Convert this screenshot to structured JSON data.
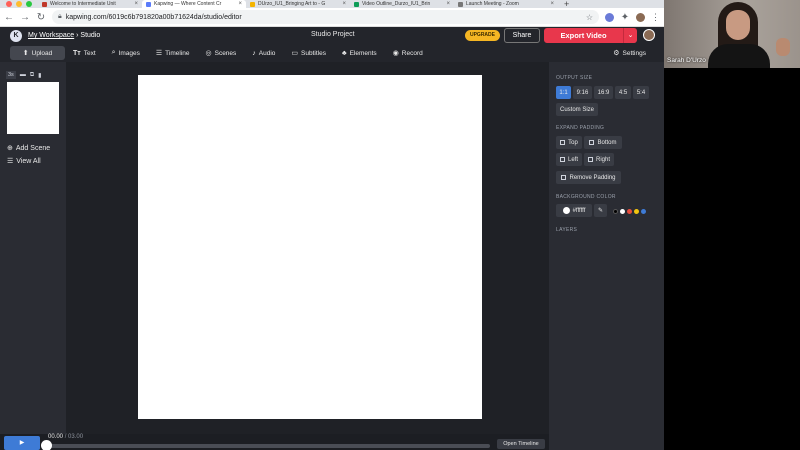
{
  "browser": {
    "tabs": [
      {
        "title": "Welcome to Intermediate Unit",
        "active": false,
        "favicon_color": "#c0392b"
      },
      {
        "title": "Kapwing — Where Content Cr",
        "active": true,
        "favicon_color": "#5b7cfa"
      },
      {
        "title": "DUrzo_IU1_Bringing Art to - G",
        "active": false,
        "favicon_color": "#f4b400"
      },
      {
        "title": "Video Outline_Durzo_IU1_Brin",
        "active": false,
        "favicon_color": "#0f9d58"
      },
      {
        "title": "Launch Meeting - Zoom",
        "active": false,
        "favicon_color": "#777777"
      }
    ],
    "url": "kapwing.com/6019c6b791820a00b71624da/studio/editor"
  },
  "header": {
    "workspace_link": "My Workspace",
    "crumb_separator": "›",
    "crumb_current": "Studio",
    "project_title": "Studio Project",
    "upgrade_label": "UPGRADE",
    "share_label": "Share",
    "export_label": "Export Video"
  },
  "toolbar": {
    "upload": "Upload",
    "text": "Text",
    "images": "Images",
    "timeline": "Timeline",
    "scenes": "Scenes",
    "audio": "Audio",
    "subtitles": "Subtitles",
    "elements": "Elements",
    "record": "Record",
    "settings": "Settings"
  },
  "scenes_panel": {
    "scene_duration": "3s",
    "add_scene": "Add Scene",
    "view_all": "View All"
  },
  "right_panel": {
    "output_size_label": "OUTPUT SIZE",
    "ratios": [
      "1:1",
      "9:16",
      "16:9",
      "4:5",
      "5:4"
    ],
    "selected_ratio": "1:1",
    "custom_size": "Custom Size",
    "expand_padding_label": "EXPAND PADDING",
    "padding_top": "Top",
    "padding_bottom": "Bottom",
    "padding_left": "Left",
    "padding_right": "Right",
    "remove_padding": "Remove Padding",
    "background_color_label": "BACKGROUND COLOR",
    "background_color_value": "#ffffff",
    "preset_colors": [
      "#000000",
      "#ffffff",
      "#e74c3c",
      "#f1c40f",
      "#3e7bd6"
    ],
    "layers_label": "LAYERS"
  },
  "timeline": {
    "play_icon": "▶",
    "current_time": "00.00",
    "separator": "/",
    "total_time": "03.00",
    "open_timeline": "Open Timeline"
  },
  "video_call": {
    "participant_name": "Sarah D'Urzo"
  },
  "colors": {
    "accent_blue": "#3e7bd6",
    "export_red": "#e8374c",
    "upgrade_yellow": "#f5b623",
    "panel_bg": "#2a2c33"
  }
}
